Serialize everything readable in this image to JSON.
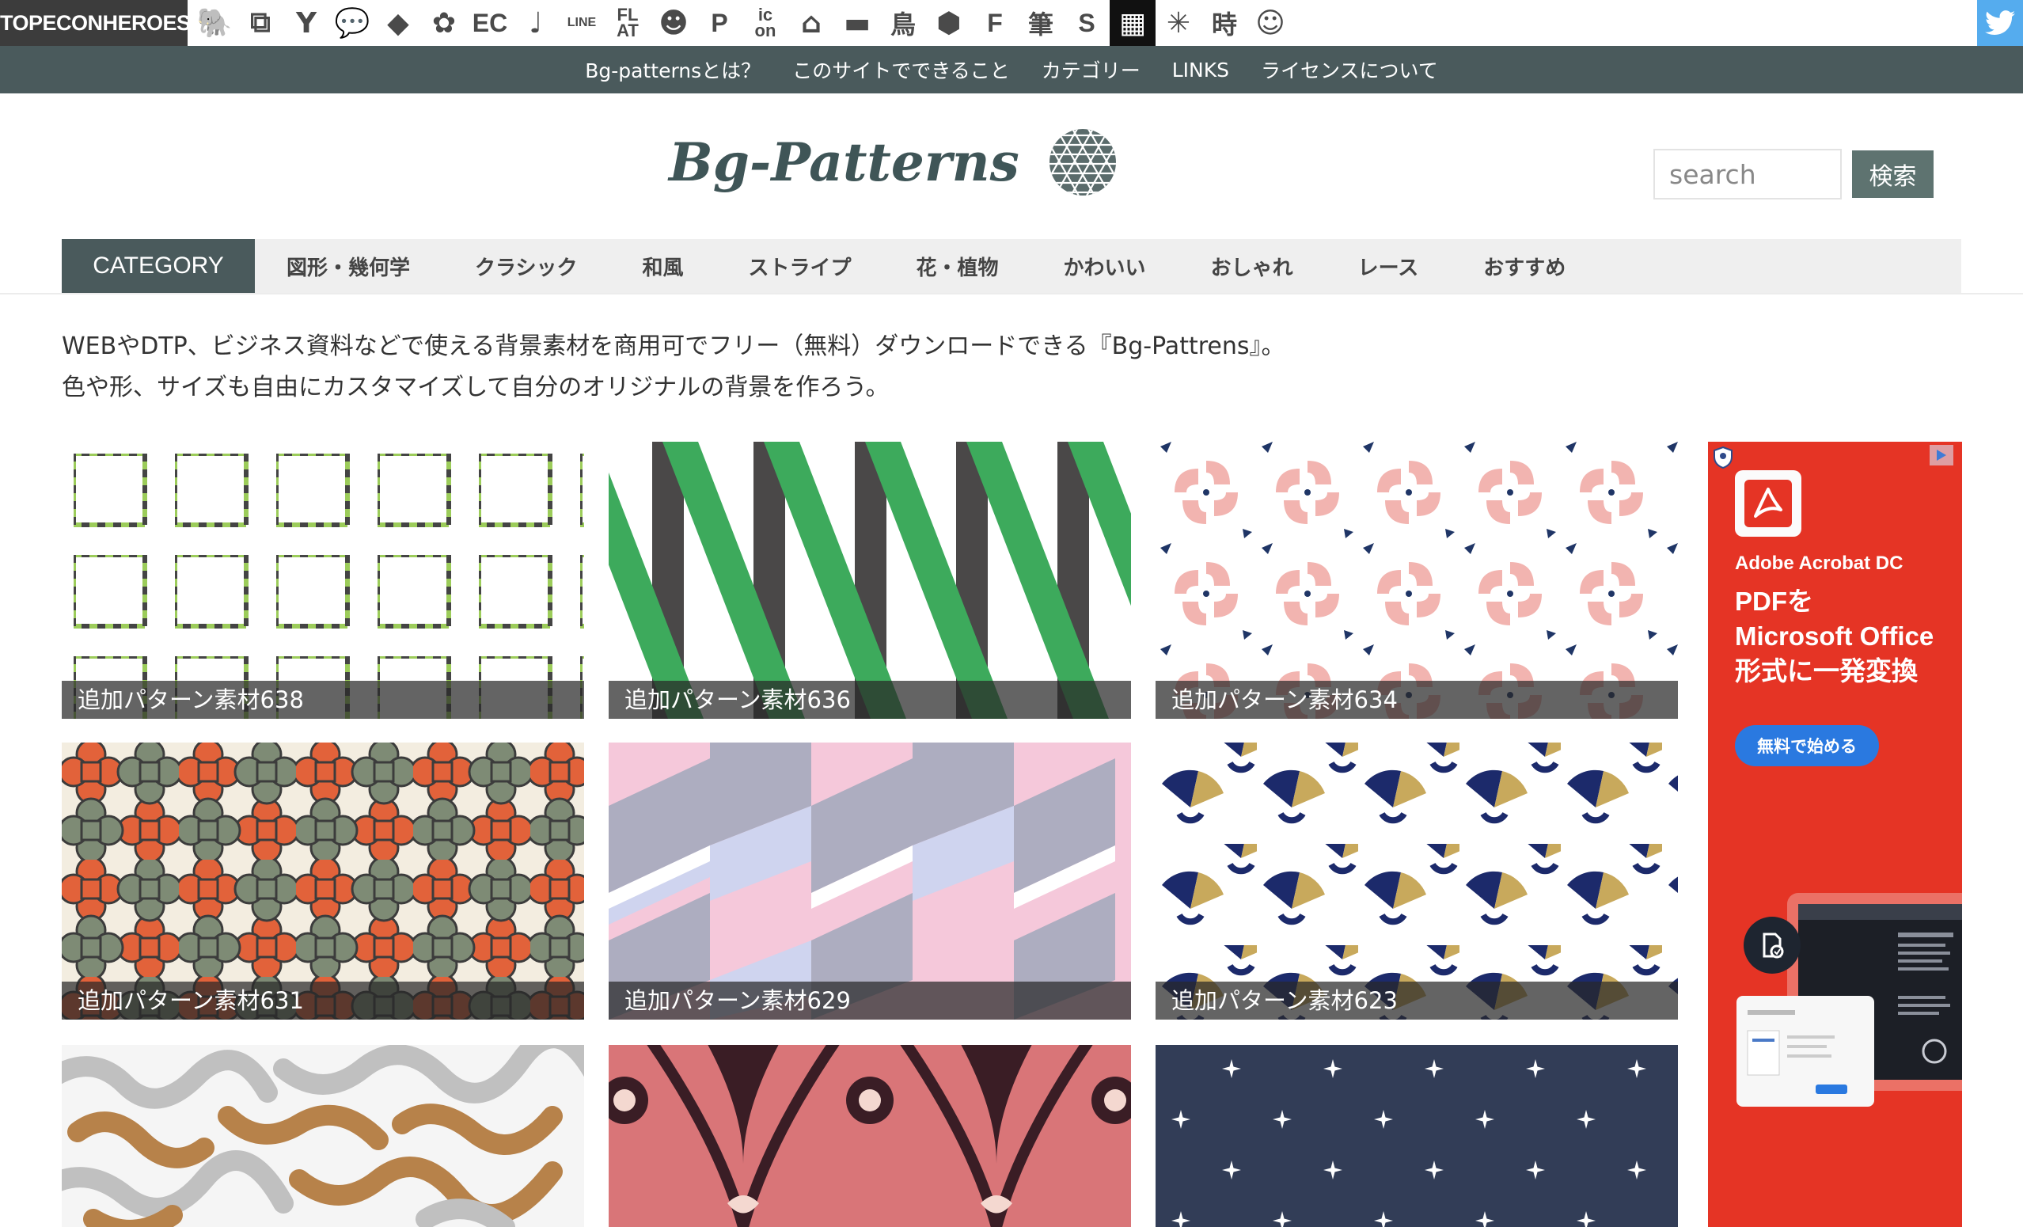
{
  "topbar": {
    "brand": "TOPECONHEROES",
    "icons": [
      {
        "name": "elephant-icon",
        "glyph": "🐘"
      },
      {
        "name": "copy-icon",
        "glyph": "⧉"
      },
      {
        "name": "figure-icon",
        "glyph": "Y"
      },
      {
        "name": "speech-bubble-icon",
        "glyph": "💬"
      },
      {
        "name": "tag-icon",
        "glyph": "◆"
      },
      {
        "name": "flower-icon",
        "glyph": "✿"
      },
      {
        "name": "ec-icon",
        "text": "EC"
      },
      {
        "name": "music-note-icon",
        "glyph": "♩"
      },
      {
        "name": "line-icon",
        "text": "LINE"
      },
      {
        "name": "flat-icon",
        "text1": "FL",
        "text2": "AT"
      },
      {
        "name": "smile-icon",
        "glyph": "☻"
      },
      {
        "name": "p-icon",
        "text": "P"
      },
      {
        "name": "icon-icon",
        "text1": "ic",
        "text2": "on"
      },
      {
        "name": "house-icon",
        "glyph": "⌂"
      },
      {
        "name": "truck-icon",
        "glyph": "▬"
      },
      {
        "name": "bird-kanji-icon",
        "text": "鳥"
      },
      {
        "name": "hexagon-icon",
        "glyph": "⬢"
      },
      {
        "name": "f-icon",
        "text": "F"
      },
      {
        "name": "brush-kanji-icon",
        "text": "筆"
      },
      {
        "name": "s-icon",
        "text": "S"
      },
      {
        "name": "grid-icon",
        "glyph": "▦",
        "active": true
      },
      {
        "name": "burst-icon",
        "glyph": "✳"
      },
      {
        "name": "time-kanji-icon",
        "text": "時"
      },
      {
        "name": "face-icon",
        "glyph": "☺"
      }
    ],
    "twitter_icon": "twitter-icon"
  },
  "subnav": {
    "items": [
      "Bg-patternsとは？",
      "このサイトでできること",
      "カテゴリー",
      "LINKS",
      "ライセンスについて"
    ]
  },
  "header": {
    "logo_text": "Bg-Patterns",
    "search_placeholder": "search",
    "search_button": "検索"
  },
  "categories": {
    "label": "CATEGORY",
    "items": [
      "図形・幾何学",
      "クラシック",
      "和風",
      "ストライプ",
      "花・植物",
      "かわいい",
      "おしゃれ",
      "レース",
      "おすすめ"
    ]
  },
  "intro": {
    "line1": "WEBやDTP、ビジネス資料などで使える背景素材を商用可でフリー（無料）ダウンロードできる『Bg-Pattrens』。",
    "line2": "色や形、サイズも自由にカスタマイズして自分のオリジナルの背景を作ろう。"
  },
  "patterns": [
    {
      "caption": "追加パターン素材638",
      "colors": [
        "#ffffff",
        "#9ccc5a",
        "#444444"
      ]
    },
    {
      "caption": "追加パターン素材636",
      "colors": [
        "#ffffff",
        "#3daa5c",
        "#4a4848"
      ]
    },
    {
      "caption": "追加パターン素材634",
      "colors": [
        "#ffffff",
        "#f2b4b0",
        "#1f3566"
      ]
    },
    {
      "caption": "追加パターン素材631",
      "colors": [
        "#f3ede0",
        "#e2623a",
        "#7e8b75"
      ]
    },
    {
      "caption": "追加パターン素材629",
      "colors": [
        "#f5c8da",
        "#adadc0",
        "#cfd4ef"
      ]
    },
    {
      "caption": "追加パターン素材623",
      "colors": [
        "#ffffff",
        "#1c2a6b",
        "#c8a95c"
      ]
    },
    {
      "caption": "",
      "colors": [
        "#f5f5f5",
        "#b7824a",
        "#c0c0c0"
      ]
    },
    {
      "caption": "",
      "colors": [
        "#d97578",
        "#3a1d25",
        "#f4d8d0"
      ]
    },
    {
      "caption": "",
      "colors": [
        "#323d57",
        "#ffffff",
        "#ffffff"
      ]
    }
  ],
  "ad": {
    "product": "Adobe Acrobat DC",
    "headline1": "PDFを",
    "headline2": "Microsoft Office",
    "headline3": "形式に一発変換",
    "cta": "無料で始める",
    "bg_color": "#e53425"
  }
}
